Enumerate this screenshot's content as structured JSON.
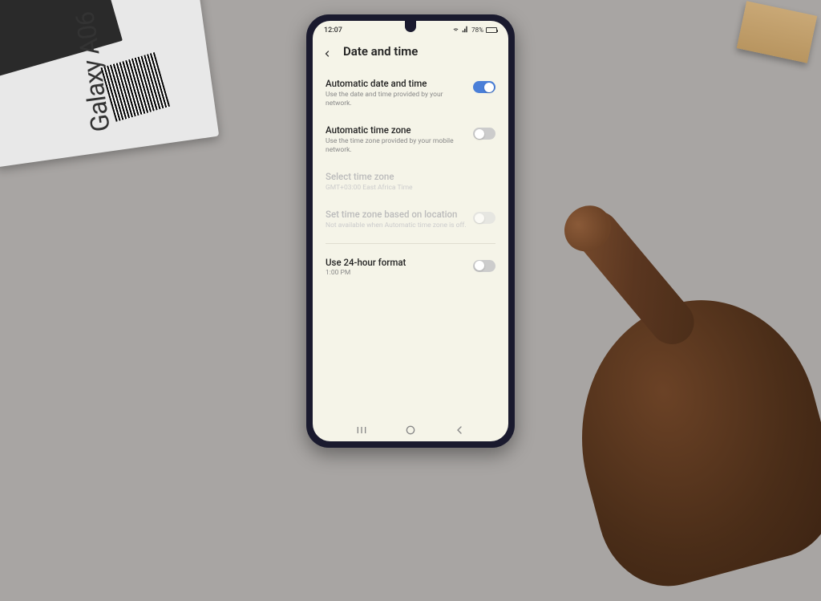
{
  "box": {
    "product_name": "Galaxy A06"
  },
  "status_bar": {
    "time": "12:07",
    "battery_percent": "78%"
  },
  "header": {
    "title": "Date and time"
  },
  "settings": {
    "auto_date_time": {
      "title": "Automatic date and time",
      "subtitle": "Use the date and time provided by your network.",
      "enabled": true
    },
    "auto_time_zone": {
      "title": "Automatic time zone",
      "subtitle": "Use the time zone provided by your mobile network.",
      "enabled": false
    },
    "select_time_zone": {
      "title": "Select time zone",
      "subtitle": "GMT+03:00 East Africa Time"
    },
    "location_time_zone": {
      "title": "Set time zone based on location",
      "subtitle": "Not available when Automatic time zone is off.",
      "enabled": false
    },
    "use_24h": {
      "title": "Use 24-hour format",
      "subtitle": "1:00 PM",
      "enabled": false
    }
  }
}
